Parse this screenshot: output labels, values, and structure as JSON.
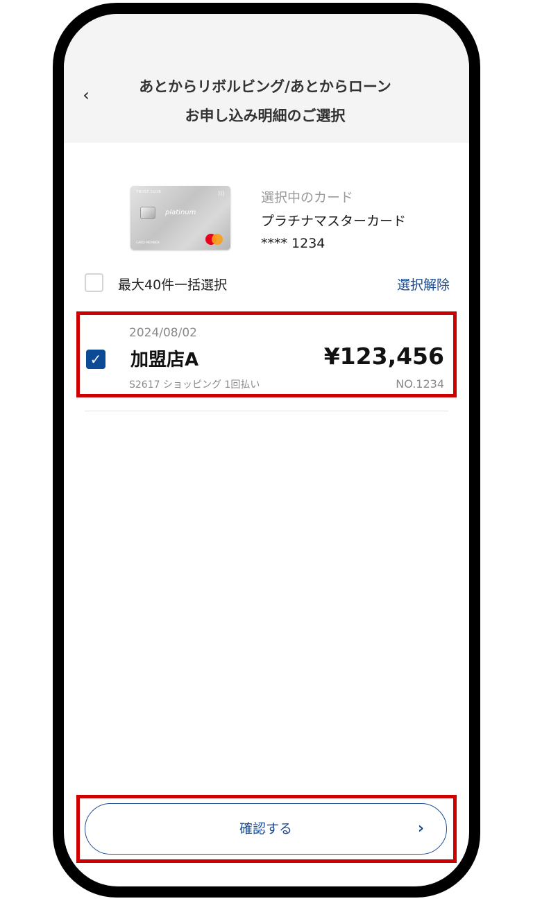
{
  "header": {
    "back_icon": "chevron-left-icon",
    "title_line1": "あとからリボルビング/あとからローン",
    "title_line2": "お申し込み明細のご選択"
  },
  "card": {
    "image_brand": "TRUST CLUB",
    "image_label": "platinum",
    "image_member": "CARD MEMBER",
    "caption": "選択中のカード",
    "name": "プラチナマスターカード",
    "number": "**** 1234"
  },
  "bulk_select": {
    "checked": false,
    "label": "最大40件一括選択",
    "clear_label": "選択解除"
  },
  "transactions": [
    {
      "checked": true,
      "date": "2024/08/02",
      "merchant": "加盟店A",
      "amount": "¥123,456",
      "detail": "S2617 ショッピング 1回払い",
      "number": "NO.1234"
    }
  ],
  "confirm": {
    "label": "確認する",
    "arrow_icon": "chevron-right-icon"
  },
  "colors": {
    "accent": "#1a4c92",
    "checkbox": "#0d4a95",
    "highlight": "#cc0000",
    "header_bg": "#f4f4f4"
  }
}
